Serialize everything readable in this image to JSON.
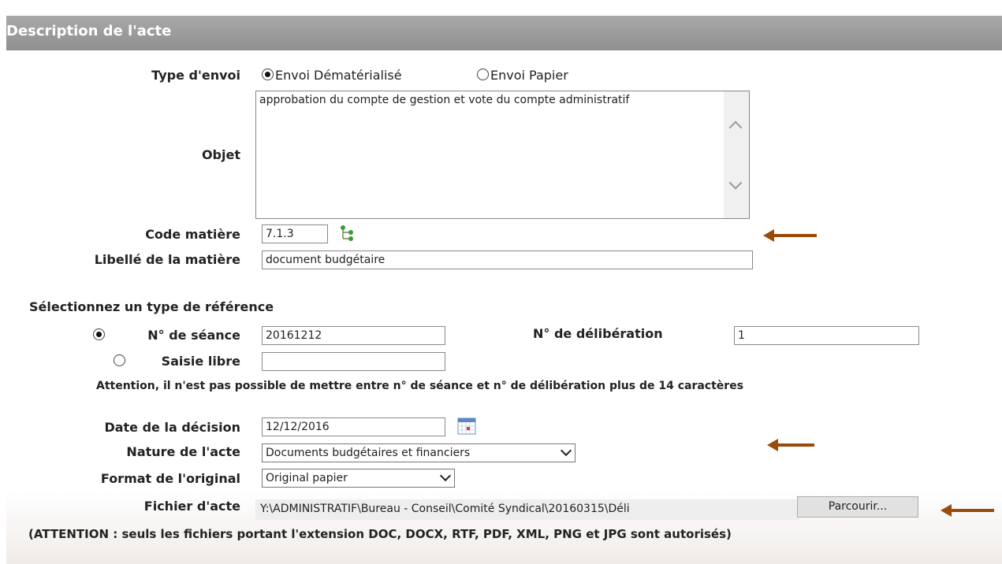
{
  "header": {
    "title": "Description de l'acte"
  },
  "type_envoi": {
    "label": "Type d'envoi",
    "options": [
      "Envoi Dématérialisé",
      "Envoi Papier"
    ],
    "selected": "Envoi Dématérialisé"
  },
  "objet": {
    "label": "Objet",
    "value": "approbation du compte de gestion et vote du compte administratif"
  },
  "code_matiere": {
    "label": "Code matière",
    "value": "7.1.3"
  },
  "libelle_matiere": {
    "label": "Libellé de la matière",
    "value": "document budgétaire"
  },
  "reference": {
    "title": "Sélectionnez un type de référence",
    "seance_label": "N° de séance",
    "seance_value": "20161212",
    "deliberation_label": "N° de délibération",
    "deliberation_value": "1",
    "saisie_label": "Saisie libre",
    "saisie_value": "",
    "warning": "Attention, il n'est pas possible de mettre entre n° de séance et n° de délibération plus de 14 caractères",
    "selected": "N° de séance"
  },
  "date_decision": {
    "label": "Date de la décision",
    "value": "12/12/2016"
  },
  "nature_acte": {
    "label": "Nature de l'acte",
    "value": "Documents budgétaires et financiers"
  },
  "format_original": {
    "label": "Format de l'original",
    "value": "Original papier"
  },
  "fichier_acte": {
    "label": "Fichier d'acte",
    "value": "Y:\\ADMINISTRATIF\\Bureau - Conseil\\Comité Syndical\\20160315\\Déli",
    "browse_label": "Parcourir..."
  },
  "file_note": "(ATTENTION : seuls les fichiers portant l'extension DOC, DOCX, RTF, PDF, XML, PNG et JPG sont autorisés)",
  "colors": {
    "header": "#999999",
    "annotation_arrow": "#9a4a0b"
  }
}
